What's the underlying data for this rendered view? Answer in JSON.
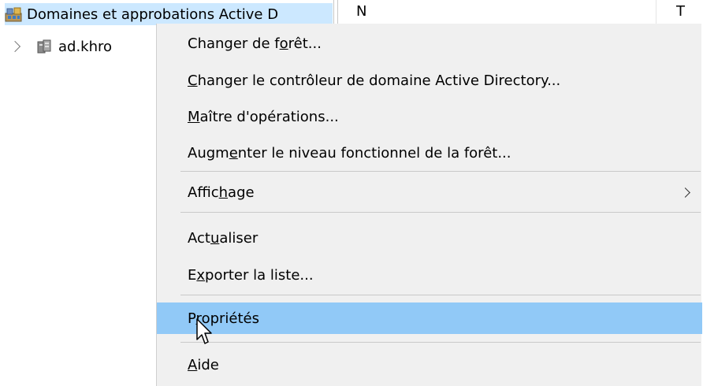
{
  "tree": {
    "root_label": "Domaines et approbations Active D",
    "root_icon": "ad-domains-trusts-icon",
    "child_label": "ad.khro",
    "child_icon": "domain-icon",
    "column_headers": [
      "N",
      "T"
    ]
  },
  "context_menu": {
    "items": [
      {
        "before": "Changer de f",
        "key": "o",
        "after": "rêt..."
      },
      {
        "before": "",
        "key": "C",
        "after": "hanger le contrôleur de domaine Active Directory..."
      },
      {
        "before": "",
        "key": "M",
        "after": "aître d'opérations..."
      },
      {
        "before": "Augm",
        "key": "e",
        "after": "nter le niveau fonctionnel de la forêt..."
      },
      {
        "before": "Affic",
        "key": "h",
        "after": "age"
      },
      {
        "before": "Act",
        "key": "u",
        "after": "aliser"
      },
      {
        "before": "E",
        "key": "x",
        "after": "porter la liste..."
      },
      {
        "before": "P",
        "key": "r",
        "after": "opriétés"
      },
      {
        "before": "",
        "key": "A",
        "after": "ide"
      }
    ],
    "highlighted_item": "Propriétés",
    "highlight_color": "#91c9f7",
    "selection_color": "#cce8ff"
  }
}
